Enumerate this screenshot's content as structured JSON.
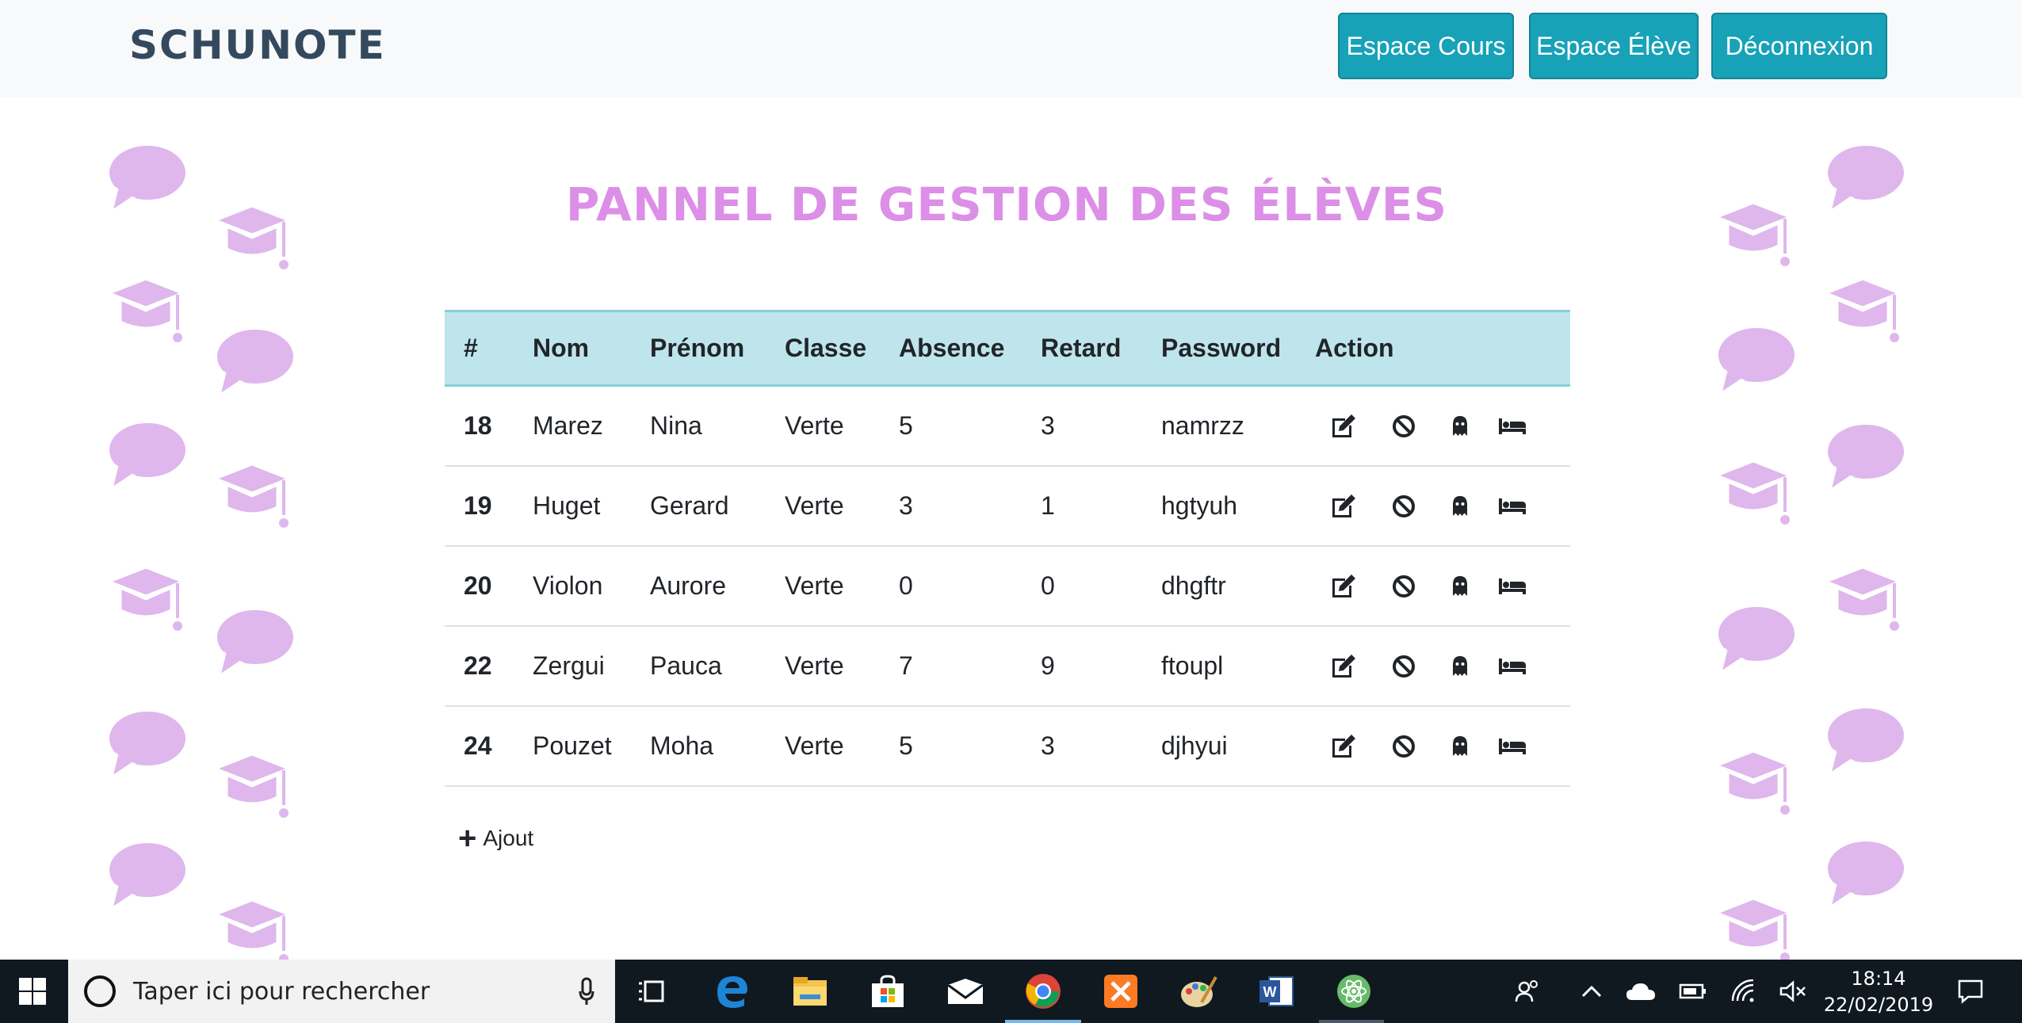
{
  "app": {
    "brand": "SCHUNOTE",
    "page_title": "PANNEL DE GESTION DES ÉLÈVES"
  },
  "nav": {
    "buttons": [
      {
        "label": "Espace Cours"
      },
      {
        "label": "Espace Élève"
      },
      {
        "label": "Déconnexion"
      }
    ]
  },
  "table": {
    "headers": [
      "#",
      "Nom",
      "Prénom",
      "Classe",
      "Absence",
      "Retard",
      "Password",
      "Action"
    ],
    "rows": [
      {
        "id": "18",
        "nom": "Marez",
        "prenom": "Nina",
        "classe": "Verte",
        "absence": "5",
        "retard": "3",
        "password": "namrzz"
      },
      {
        "id": "19",
        "nom": "Huget",
        "prenom": "Gerard",
        "classe": "Verte",
        "absence": "3",
        "retard": "1",
        "password": "hgtyuh"
      },
      {
        "id": "20",
        "nom": "Violon",
        "prenom": "Aurore",
        "classe": "Verte",
        "absence": "0",
        "retard": "0",
        "password": "dhgftr"
      },
      {
        "id": "22",
        "nom": "Zergui",
        "prenom": "Pauca",
        "classe": "Verte",
        "absence": "7",
        "retard": "9",
        "password": "ftoupl"
      },
      {
        "id": "24",
        "nom": "Pouzet",
        "prenom": "Moha",
        "classe": "Verte",
        "absence": "5",
        "retard": "3",
        "password": "djhyui"
      }
    ],
    "row_actions": [
      "edit-icon",
      "ban-icon",
      "ghost-icon",
      "bed-icon"
    ]
  },
  "add": {
    "label": "Ajout"
  },
  "taskbar": {
    "search_placeholder": "Taper ici pour rechercher",
    "time": "18:14",
    "date": "22/02/2019",
    "apps": [
      "task-view-icon",
      "edge-icon",
      "file-explorer-icon",
      "store-icon",
      "mail-icon",
      "chrome-icon",
      "xampp-icon",
      "paint-icon",
      "word-icon",
      "atom-icon"
    ]
  },
  "colors": {
    "accent": "#17a2b8",
    "title": "#dc8fe6",
    "table_head": "#bee5eb",
    "decoration": "#dfb7ec",
    "brand": "#34495e"
  }
}
